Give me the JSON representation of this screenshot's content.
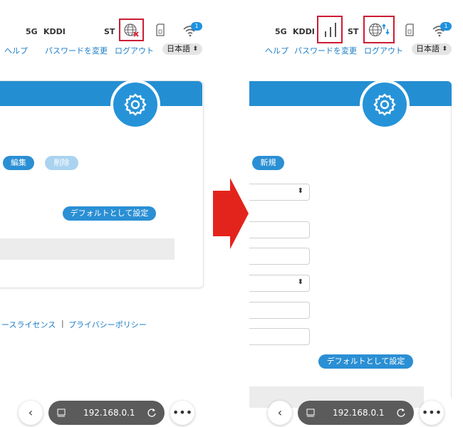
{
  "status_bar": {
    "network_type": "5G",
    "carrier": "KDDI",
    "st_label": "ST",
    "wifi_badge_count": "1"
  },
  "header_links": {
    "help": "ヘルプ",
    "change_password": "パスワードを変更",
    "logout": "ログアウト",
    "language": "日本語"
  },
  "left_panel": {
    "edit_button": "編集",
    "delete_button": "削除",
    "set_default_button": "デフォルトとして設定",
    "footer_license": "ースライセンス",
    "footer_separator": "|",
    "footer_privacy": "プライバシーポリシー"
  },
  "right_panel": {
    "new_button": "新規",
    "set_default_button": "デフォルトとして設定"
  },
  "browser": {
    "address": "192.168.0.1"
  },
  "icons": {
    "globe_disconnected": "globe-x-icon",
    "globe_connected": "globe-transfer-icon",
    "signal": "signal-bars-icon",
    "sim": "sim-card-icon",
    "wifi": "wifi-icon",
    "gear": "gear-icon",
    "transition_arrow": "arrow-right-icon"
  },
  "colors": {
    "accent_blue": "#248ed2",
    "highlight_red": "#cc1d35",
    "arrow_red": "#e3241c"
  }
}
